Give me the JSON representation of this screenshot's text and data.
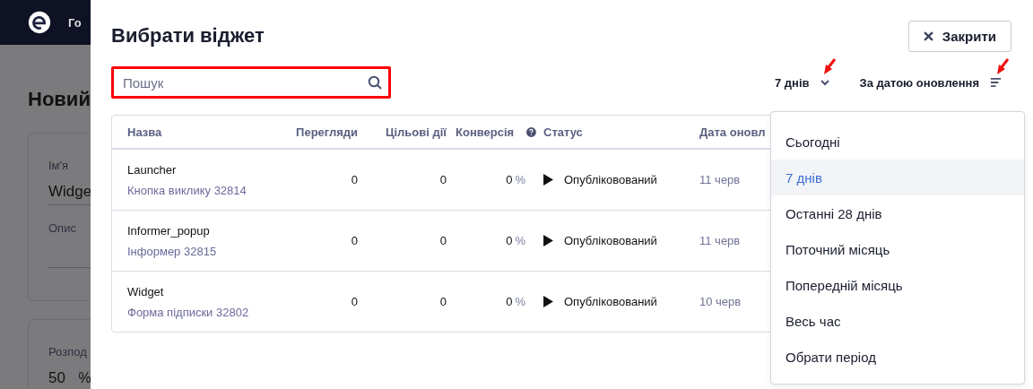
{
  "background_page": {
    "nav_item": "Го",
    "heading": "Новий",
    "cards": [
      {
        "fields": [
          {
            "label": "Ім'я",
            "value": "Widge"
          },
          {
            "label": "Опис"
          }
        ]
      },
      {
        "fields": [
          {
            "label": "Розпод",
            "value": "50",
            "unit": "%"
          }
        ]
      }
    ]
  },
  "modal": {
    "title": "Вибрати віджет",
    "close_button": "Закрити",
    "search": {
      "placeholder": "Пошук"
    },
    "period_filter": {
      "label": "7 днів",
      "expanded": true
    },
    "sort": {
      "label": "За датою оновлення"
    },
    "table": {
      "columns": [
        "Назва",
        "Перегляди",
        "Цільові дії",
        "Конверсія",
        "Статус",
        "Дата оновл"
      ],
      "rows": [
        {
          "name": "Launcher",
          "type": "Кнопка виклику 32814",
          "views": "0",
          "actions": "0",
          "conversion": "0",
          "unit": "%",
          "status": "Опубліковований",
          "date": "11 черв"
        },
        {
          "name": "Informer_popup",
          "type": "Інформер 32815",
          "views": "0",
          "actions": "0",
          "conversion": "0",
          "unit": "%",
          "status": "Опубліковований",
          "date": "11 черв"
        },
        {
          "name": "Widget",
          "type": "Форма підписки 32802",
          "views": "0",
          "actions": "0",
          "conversion": "0",
          "unit": "%",
          "status": "Опубліковований",
          "date": "10 черв"
        }
      ]
    },
    "period_menu": [
      {
        "label": "Сьогодні",
        "selected": false
      },
      {
        "label": "7 днів",
        "selected": true
      },
      {
        "label": "Останні 28 днів",
        "selected": false
      },
      {
        "label": "Поточний місяць",
        "selected": false
      },
      {
        "label": "Попередній місяць",
        "selected": false
      },
      {
        "label": "Весь час",
        "selected": false
      },
      {
        "label": "Обрати період",
        "selected": false
      }
    ]
  }
}
